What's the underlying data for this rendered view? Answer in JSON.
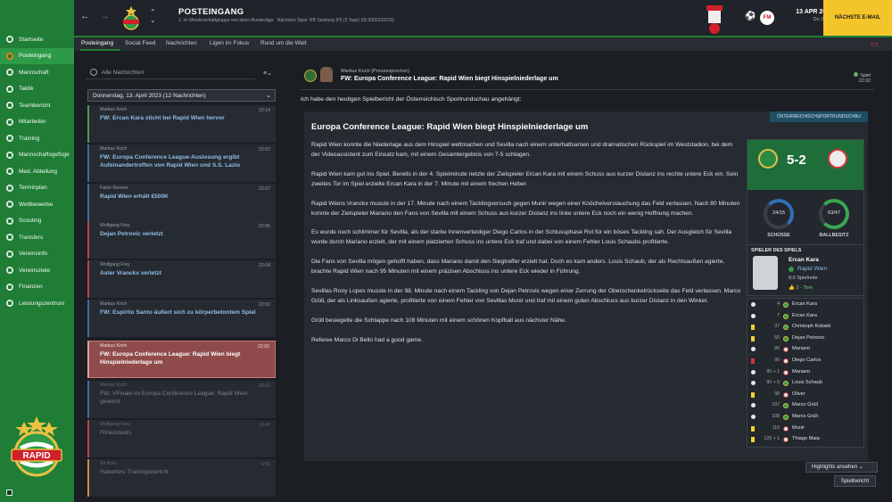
{
  "sidebar": {
    "items": [
      {
        "label": "Startseite",
        "active": false
      },
      {
        "label": "Posteingang",
        "active": true,
        "badge": true
      },
      {
        "label": "Mannschaft",
        "active": false
      },
      {
        "label": "Taktik",
        "active": false
      },
      {
        "label": "Teambericht",
        "active": false
      },
      {
        "label": "Mitarbeiter",
        "active": false
      },
      {
        "label": "Training",
        "active": false
      },
      {
        "label": "Mannschaftsgefüge",
        "active": false
      },
      {
        "label": "Med. Abteilung",
        "active": false
      },
      {
        "label": "Terminplan",
        "active": false
      },
      {
        "label": "Wettbewerbe",
        "active": false
      },
      {
        "label": "Scouting",
        "active": false
      },
      {
        "label": "Transfers",
        "active": false
      },
      {
        "label": "Vereinsinfo",
        "active": false
      },
      {
        "label": "Vereinsziele",
        "active": false
      },
      {
        "label": "Finanzen",
        "active": false
      },
      {
        "label": "Leistungszentrum",
        "active": false
      }
    ],
    "logo_text": "RAPID"
  },
  "header": {
    "title": "POSTEINGANG",
    "subtitle": "1. im Meisterschaftgruppe von tipico-Bundesliga · Nächstes Spiel: RB Salzburg (H) (3 Tage) (ID:2000133223)",
    "date": "13 APR 2023",
    "day_time": "Do 22:15",
    "next_button": "NÄCHSTE E-MAIL",
    "fm_badge": "FM"
  },
  "tabs": [
    "Posteingang",
    "Social Feed",
    "Nachrichten",
    "Ligen im Fokus",
    "Rund um die Welt"
  ],
  "inbox": {
    "search_placeholder": "Alle Nachrichten",
    "date_group": "Donnerstag, 13. April 2023 (12 Nachrichten)",
    "messages": [
      {
        "sender": "Markus Koch",
        "time": "22:14",
        "subject": "FW: Ercan Kara sticht bei Rapid Wien hervor",
        "tone": "green"
      },
      {
        "sender": "Markus Koch",
        "time": "22:07",
        "subject": "FW: Europa Conference League-Auslosung ergibt Aufeinandertreffen von Rapid Wien und S.S. Lazio",
        "tone": "blue"
      },
      {
        "sender": "Fabio Renner",
        "time": "22:07",
        "subject": "Rapid Wien erhält €500K",
        "tone": "blue"
      },
      {
        "sender": "Wolfgang Frey",
        "time": "22:05",
        "subject": "Dejan Petrovic verletzt",
        "tone": "red"
      },
      {
        "sender": "Wolfgang Frey",
        "time": "22:04",
        "subject": "Aster Vranckx verletzt",
        "tone": "red"
      },
      {
        "sender": "Markus Koch",
        "time": "22:02",
        "subject": "FW: Espírito Santo äußert sich zu körperbetontem Spiel",
        "tone": "blue"
      },
      {
        "sender": "Markus Koch",
        "time": "22:02",
        "subject": "FW: Europa Conference League: Rapid Wien biegt Hinspielniederlage um",
        "tone": "selected"
      },
      {
        "sender": "Markus Koch",
        "time": "22:02",
        "subject": "FW: VFinale im Europa Conference League: Rapid Wien gewinnt",
        "tone": "dim"
      },
      {
        "sender": "Wolfgang Frey",
        "time": "19:47",
        "subject": "Fitnesstests",
        "tone": "dim red"
      },
      {
        "sender": "Sir Boei",
        "time": "6:51",
        "subject": "Haberlers Trainingsbericht",
        "tone": "dim orange"
      }
    ]
  },
  "message": {
    "sender": "Markus Koch (Pressesprecher)",
    "subject": "FW: Europa Conference League: Rapid Wien biegt Hinspielniederlage um",
    "flag": "Spiel",
    "time": "22:02",
    "intro": "Ich habe den heutigen Spielbericht der Österreichisch Sportrundschau angehängt:",
    "source_tag": "ÖSTERREICHISCHSPORTRUNDSCHAU",
    "article_title": "Europa Conference League: Rapid Wien biegt Hinspielniederlage um",
    "paragraphs": [
      "Rapid Wien konnte die Niederlage aus dem Hinspiel wettmachen und Sevilla nach einem unterhaltsamen und dramatischen Rückspiel im Weststadion, bei dem der Videoassistent zum Einsatz kam, mit einem Gesamtergebnis von 7-5 schlagen.",
      "Rapid Wien kam gut ins Spiel. Bereits in der 4. Spielminute netzte der Zielspieler Ercan Kara mit einem Schuss aus kurzer Distanz ins rechte untere Eck ein. Sein zweites Tor im Spiel erzielte Ercan Kara in der 7. Minute mit einem frechen Heber.",
      "Rapid Wiens Vranckx musste in der 17. Minute nach einem Tacklingversuch gegen Munir wegen einer Knöchelverstauchung das Feld verlassen. Nach 80 Minuten konnte der Zielspieler Mariano den Fans von Sevilla mit einem Schuss aus kurzer Distanz ins linke untere Eck noch ein wenig Hoffnung machen.",
      "Es wurde noch schlimmer für Sevilla, als der starke Innenverteidiger Diego Carlos in der Schlussphase Rot für ein böses Tackling sah. Der Ausgleich für Sevilla wurde durch Mariano erzielt, der mit einem platzierten Schuss ins untere Eck traf und dabei von einem Fehler Louis Schaubs profitierte.",
      "Die Fans von Sevilla mögen gehofft haben, dass Mariano damit den Siegtreffer erzielt hat. Doch es kam anders. Louis Schaub, der als Rechtsaußen agierte, brachte Rapid Wien nach 95 Minuten mit einem präzisen Abschluss ins untere Eck wieder in Führung.",
      "Sevillas Rony Lopes musste in der 98. Minute nach einem Tackling von Dejan Petrovic wegen einer Zerrung der Oberschenkelrückseite das Feld verlassen. Marco Grüll, der als Linksaußen agierte, profitierte von einem Fehler von Sevillas Munir und traf mit einem guten Abschluss aus kurzer Distanz in den Winkel.",
      "Grüll besiegelte die Schlappe nach 108 Minuten mit einem schönen Kopfball aus nächster Nähe.",
      "Referee Marco Di Bello had a good game."
    ]
  },
  "match": {
    "score": "5-2",
    "shots": "24/15",
    "shots_label": "SCHÜSSE",
    "possession": "63/47",
    "possession_label": "BALLBESITZ",
    "motm_heading": "SPIELER DES SPIELS",
    "motm_name": "Ercan Kara",
    "motm_club": "Rapid Wien",
    "motm_rating": "9.0 Spielnote",
    "motm_goals": "2 - Tore",
    "events": [
      {
        "min": "4",
        "name": "Ercan Kara",
        "type": "goal",
        "team": "home"
      },
      {
        "min": "7",
        "name": "Ercan Kara",
        "type": "goal",
        "team": "home"
      },
      {
        "min": "37",
        "name": "Christoph Kobald",
        "type": "yellow",
        "team": "home"
      },
      {
        "min": "60",
        "name": "Dejan Petrovic",
        "type": "yellow",
        "team": "home"
      },
      {
        "min": "80",
        "name": "Mariano",
        "type": "goal",
        "team": "away"
      },
      {
        "min": "90",
        "name": "Diego Carlos",
        "type": "red",
        "team": "away"
      },
      {
        "min": "90 + 1",
        "name": "Mariano",
        "type": "goal",
        "team": "away"
      },
      {
        "min": "90 + 5",
        "name": "Louis Schaub",
        "type": "goal",
        "team": "home"
      },
      {
        "min": "98",
        "name": "Oliver",
        "type": "yellow",
        "team": "away"
      },
      {
        "min": "107",
        "name": "Marco Grüll",
        "type": "goal",
        "team": "home"
      },
      {
        "min": "108",
        "name": "Marco Grüll",
        "type": "goal",
        "team": "home"
      },
      {
        "min": "110",
        "name": "Munir",
        "type": "yellow",
        "team": "away"
      },
      {
        "min": "120 + 1",
        "name": "Thiago Maia",
        "type": "yellow",
        "team": "away"
      }
    ]
  },
  "footer": {
    "highlights": "Highlights ansehen",
    "report": "Spielbericht"
  },
  "colors": {
    "sidebar": "#1f7d36",
    "accent": "#f4c52a",
    "selected": "#8f4b4b",
    "link": "#8fbfe8"
  }
}
